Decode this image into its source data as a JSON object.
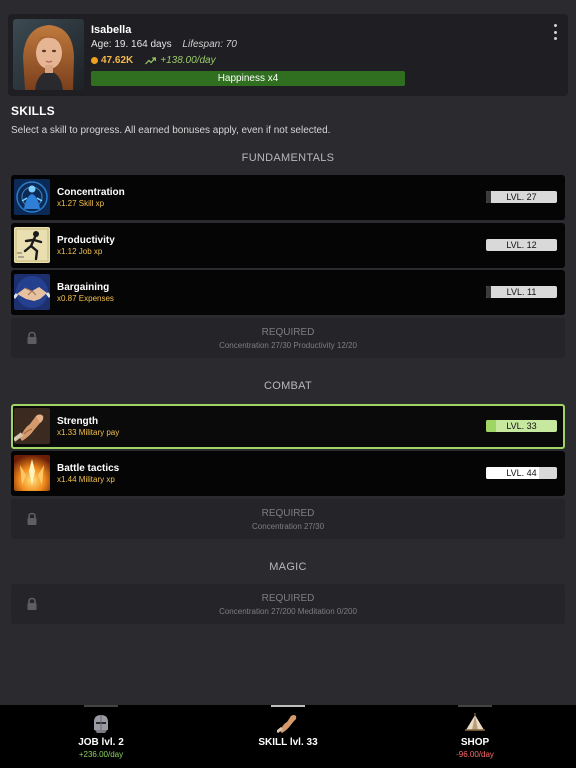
{
  "character": {
    "name": "Isabella",
    "age": "Age: 19. 164 days",
    "lifespan": "Lifespan: 70",
    "money": "47.62K",
    "income": "+138.00/day",
    "happiness": "Happiness x4"
  },
  "skills_section": {
    "title": "SKILLS",
    "description": "Select a skill to progress. All earned bonuses apply, even if not selected."
  },
  "categories": {
    "fundamentals": "FUNDAMENTALS",
    "combat": "COMBAT",
    "magic": "MAGIC"
  },
  "skills": [
    {
      "name": "Concentration",
      "bonus": "x1.27 Skill xp",
      "level": "LVL. 27",
      "progress": 0.05,
      "icon": "concentration-icon"
    },
    {
      "name": "Productivity",
      "bonus": "x1.12 Job xp",
      "level": "LVL. 12",
      "progress": 0.0,
      "icon": "productivity-icon"
    },
    {
      "name": "Bargaining",
      "bonus": "x0.87 Expenses",
      "level": "LVL. 11",
      "progress": 0.05,
      "icon": "bargaining-icon"
    },
    {
      "name": "Strength",
      "bonus": "x1.33 Military pay",
      "level": "LVL. 33",
      "progress": 0.14,
      "icon": "strength-icon",
      "selected": true
    },
    {
      "name": "Battle tactics",
      "bonus": "x1.44 Military xp",
      "level": "LVL. 44",
      "progress": 0.75,
      "icon": "battle-tactics-icon"
    }
  ],
  "locked": {
    "fundamentals": {
      "title": "REQUIRED",
      "requirement": "Concentration 27/30 Productivity 12/20"
    },
    "combat": {
      "title": "REQUIRED",
      "requirement": "Concentration 27/30"
    },
    "magic": {
      "title": "REQUIRED",
      "requirement": "Concentration 27/200 Meditation 0/200"
    }
  },
  "nav": [
    {
      "label": "JOB lvl. 2",
      "sub": "+236.00/day",
      "icon": "knight-helmet-icon"
    },
    {
      "label": "SKILL lvl. 33",
      "sub": "",
      "icon": "strength-icon",
      "active": true
    },
    {
      "label": "SHOP",
      "sub": "-96.00/day",
      "icon": "tent-icon"
    }
  ],
  "colors": {
    "accent_green": "#9fd563",
    "happiness_bar": "#2f6f1f",
    "bonus_gold": "#f2c14e",
    "positive": "#8fd460",
    "negative": "#ff6a6a"
  }
}
